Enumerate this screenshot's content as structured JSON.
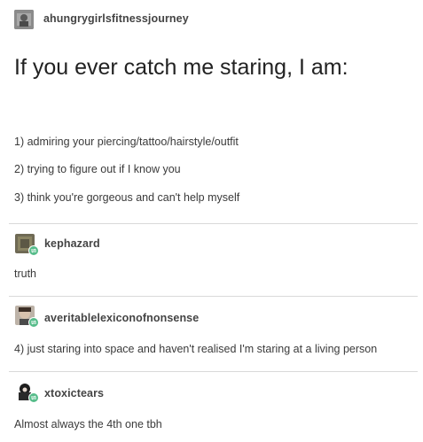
{
  "posts": [
    {
      "username": "ahungrygirlsfitnessjourney",
      "title": "If you ever catch me staring, I am:",
      "list": [
        "1) admiring your piercing/tattoo/hairstyle/outfit",
        "2) trying to figure out if I know you",
        "3) think you're gorgeous and can't help myself"
      ]
    },
    {
      "username": "kephazard",
      "text": "truth"
    },
    {
      "username": "averitablelexiconofnonsense",
      "text": "4) just staring into space and haven't realised I'm staring at a living person"
    },
    {
      "username": "xtoxictears",
      "text": "Almost always the 4th one tbh"
    }
  ],
  "colors": {
    "reblog_badge": "#56bc8a",
    "divider": "#d9d9d9"
  }
}
